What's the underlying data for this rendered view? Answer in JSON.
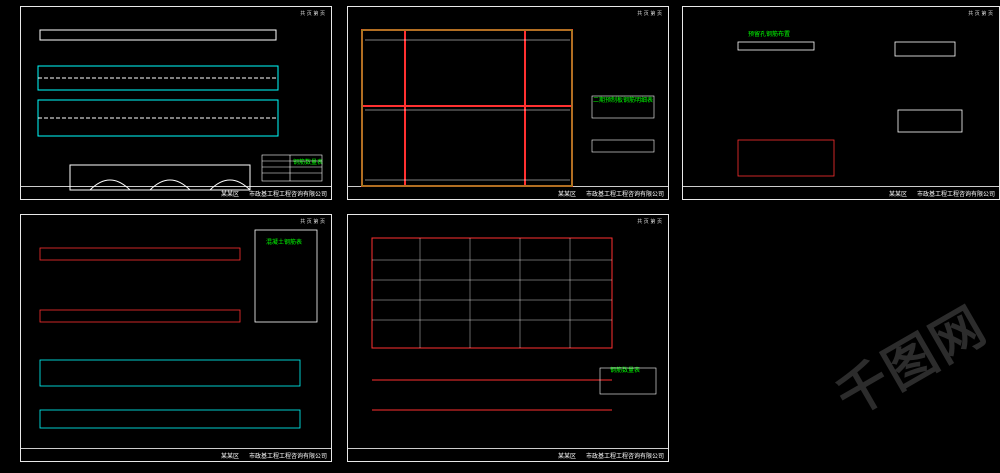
{
  "company": "市政基工程工程咨询有限公司",
  "project": "某某区",
  "watermark": "千图网",
  "sheets": [
    {
      "header": "共 页 第 页",
      "title": "钢筋数量表"
    },
    {
      "header": "共 页 第 页",
      "title": "二期预制板钢筋明细表"
    },
    {
      "header": "共 页 第 页",
      "title": "预留孔钢筋布置"
    },
    {
      "header": "共 页 第 页",
      "title": "混凝土钢筋表"
    },
    {
      "header": "共 页 第 页",
      "title": "钢筋数量表"
    }
  ]
}
